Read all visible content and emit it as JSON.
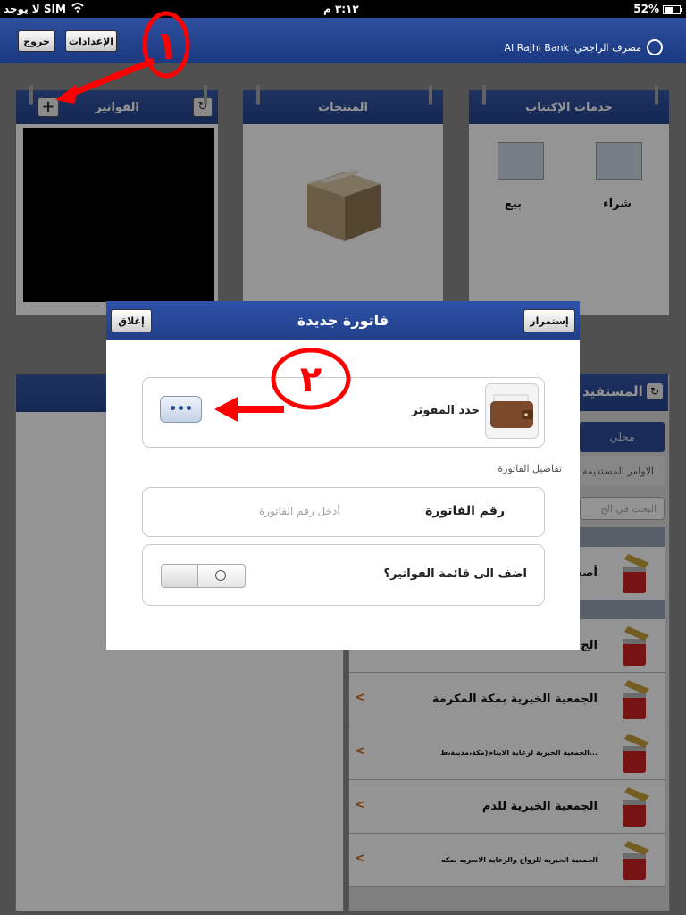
{
  "status_bar": {
    "carrier": "لا يوجد SIM",
    "time": "٣:١٢ م",
    "battery": "52%"
  },
  "header": {
    "logout_label": "خروج",
    "settings_label": "الإعدادات",
    "brand_en": "Al Rajhi Bank",
    "brand_ar": "مصرف الراجحي"
  },
  "panels": {
    "bills_title": "الفواتير",
    "products_title": "المنتجات",
    "services_title": "خدمات الإكتتاب",
    "buy_label": "شراء",
    "sell_label": "بيع"
  },
  "beneficiaries": {
    "title_fragment": "المستفيد",
    "local_tab": "محلي",
    "orders_fragment": "الاوامر المستديمة",
    "search_placeholder": "البحث في الج",
    "first_item_fragment": "أصد",
    "second_item_fragment": "الج",
    "items": [
      "الجمعية الخيرية بمكة المكرمة",
      "الجمعية الخيرية لرعاية الايتام(مكة،مدينة،ط...",
      "الجمعية الخيرية للدم",
      "الجمعية الخيرية للزواج والرعاية الاسريه بمكه"
    ]
  },
  "dialog": {
    "title": "فاتورة جديدة",
    "close_label": "إغلاق",
    "continue_label": "إستمرار",
    "biller_label": "حدد المفوتر",
    "biller_button": "•••",
    "section_header": "تفاصيل الفاتورة",
    "invoice_label": "رقم الفاتورة",
    "invoice_placeholder": "أدخل رقم الفاتورة",
    "add_to_list_label": "اضف الى قائمة الفواتير؟",
    "add_to_list_on": false
  },
  "annotations": {
    "first": "١",
    "second": "٢"
  },
  "colors": {
    "header_blue": "#24448f",
    "annotation_red": "#ff0000",
    "chevron_orange": "#d2691e"
  }
}
